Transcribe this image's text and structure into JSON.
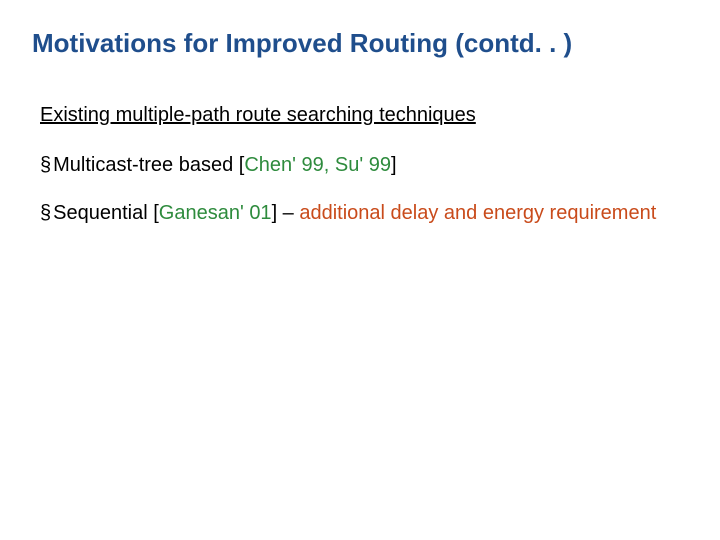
{
  "title": "Motivations for Improved Routing (contd. . )",
  "subheading": "Existing multiple-path route searching techniques",
  "bullets": [
    {
      "marker": "§",
      "pre": "Multicast-tree based [",
      "ref": "Chen' 99, Su' 99",
      "post": "]"
    },
    {
      "marker": "§",
      "pre": "Sequential [",
      "ref": "Ganesan' 01",
      "mid": "] – ",
      "emph": "additional delay and energy requirement"
    }
  ]
}
